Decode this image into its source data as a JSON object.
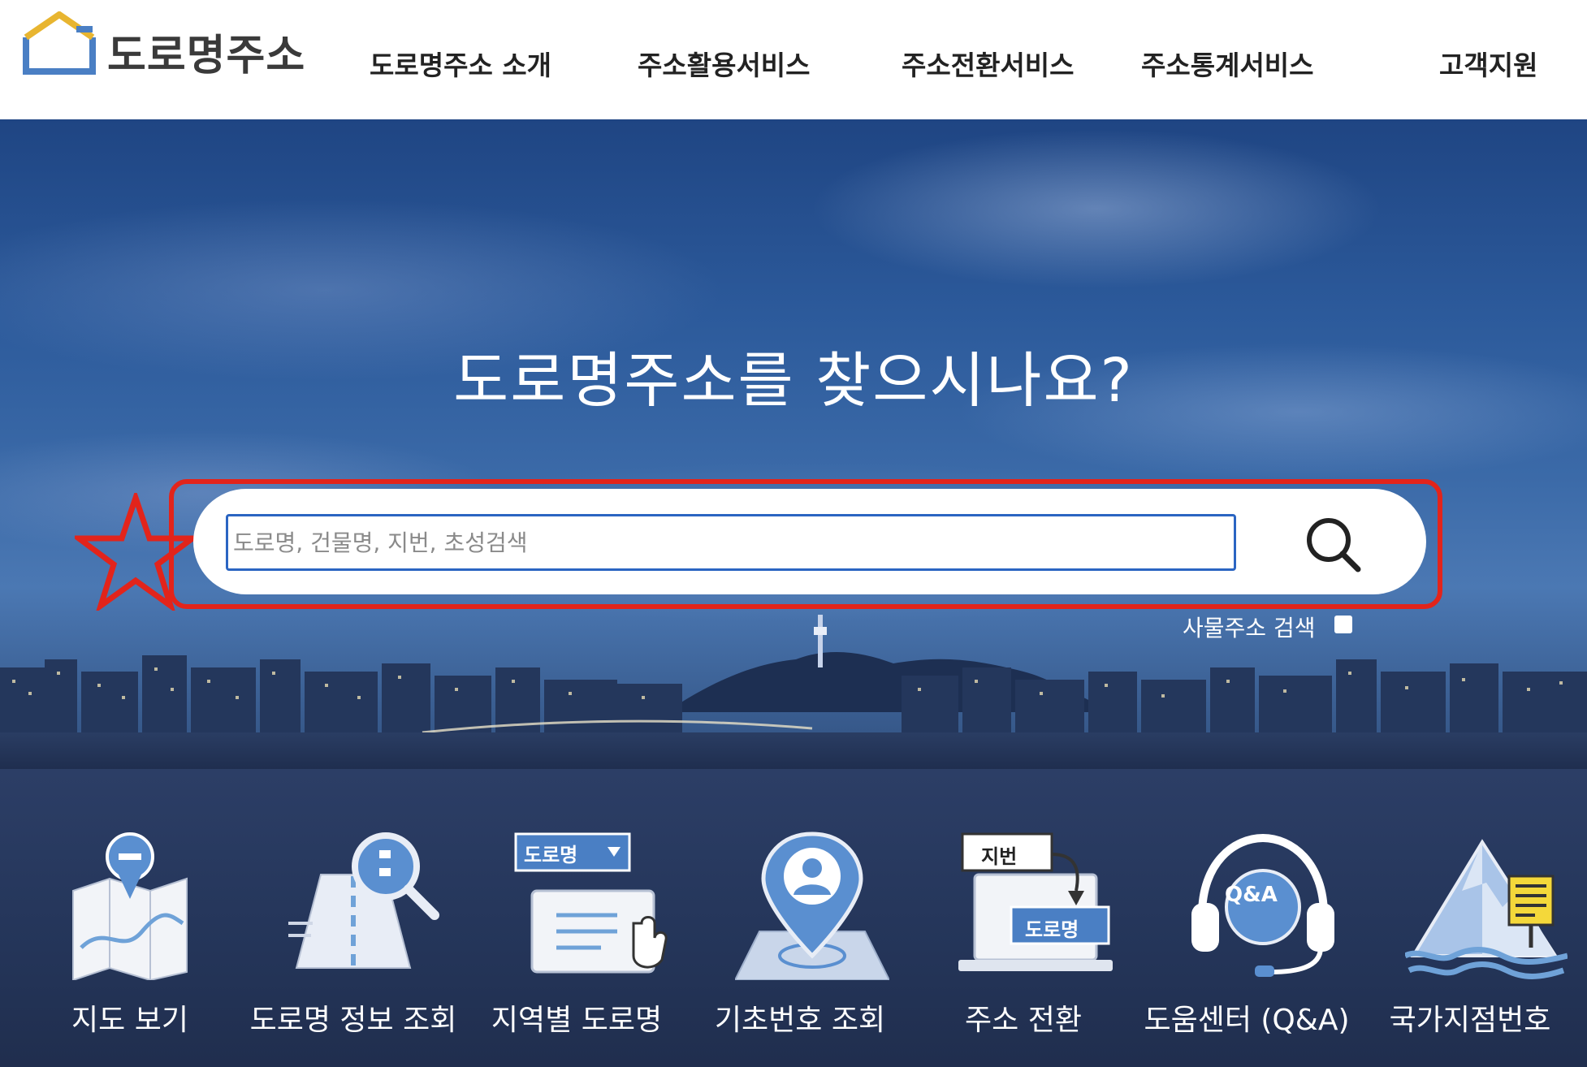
{
  "header": {
    "logo_text": "도로명주소",
    "nav": [
      "도로명주소 소개",
      "주소활용서비스",
      "주소전환서비스",
      "주소통계서비스",
      "고객지원"
    ]
  },
  "hero": {
    "title": "도로명주소를 찾으시나요?",
    "search": {
      "placeholder": "도로명, 건물명, 지번, 초성검색",
      "value": ""
    },
    "object_search_label": "사물주소 검색"
  },
  "services": [
    {
      "label": "지도 보기",
      "icon": "map-icon"
    },
    {
      "label": "도로명 정보 조회",
      "icon": "road-info-search-icon"
    },
    {
      "label": "지역별 도로명",
      "icon": "regional-road-name-icon",
      "badge": "도로명"
    },
    {
      "label": "기초번호 조회",
      "icon": "location-pin-person-icon"
    },
    {
      "label": "주소 전환",
      "icon": "address-conversion-icon",
      "badge_top": "지번",
      "badge_bottom": "도로명"
    },
    {
      "label": "도움센터 (Q&A)",
      "icon": "headset-qa-icon",
      "badge": "Q&A"
    },
    {
      "label": "국가지점번호",
      "icon": "mountain-sign-icon"
    }
  ],
  "colors": {
    "highlight": "#e2241b",
    "input_border": "#2b65c2",
    "logo_blue": "#4a7fc4",
    "logo_gold": "#e8b530"
  }
}
